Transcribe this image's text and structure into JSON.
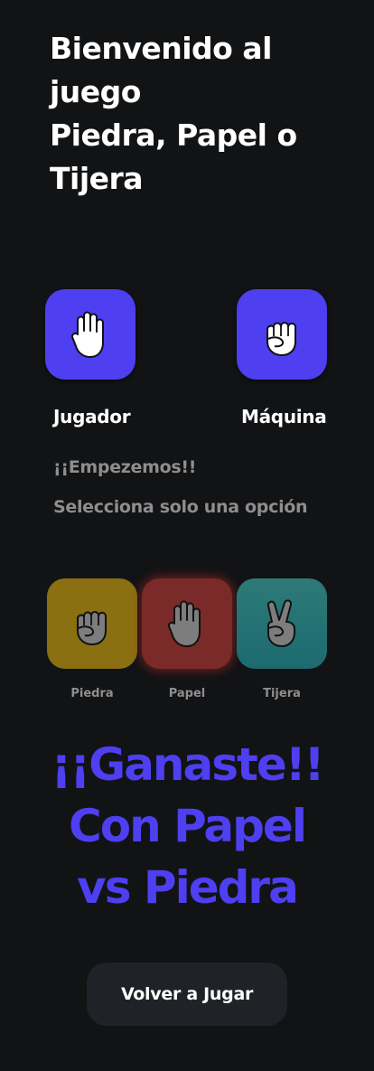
{
  "header": {
    "title_line1": "Bienvenido al",
    "title_line2": "juego",
    "title_line3": "Piedra, Papel o",
    "title_line4": "Tijera"
  },
  "players": {
    "player_label": "Jugador",
    "machine_label": "Máquina",
    "player_choice_icon": "hand-open-icon",
    "machine_choice_icon": "fist-icon",
    "accent_color": "#4e3ff0"
  },
  "messages": {
    "start": "¡¡Empezemos!!",
    "instruction": "Selecciona solo una opción"
  },
  "options": [
    {
      "label": "Piedra",
      "icon": "fist-icon",
      "color": "#8a7010"
    },
    {
      "label": "Papel",
      "icon": "hand-open-icon",
      "color": "#7a2a28"
    },
    {
      "label": "Tijera",
      "icon": "peace-hand-icon",
      "color": "#2d7a78"
    }
  ],
  "result": {
    "line1": "¡¡Ganaste!!",
    "line2": "Con Papel",
    "line3": "vs Piedra"
  },
  "actions": {
    "play_again": "Volver a Jugar"
  }
}
